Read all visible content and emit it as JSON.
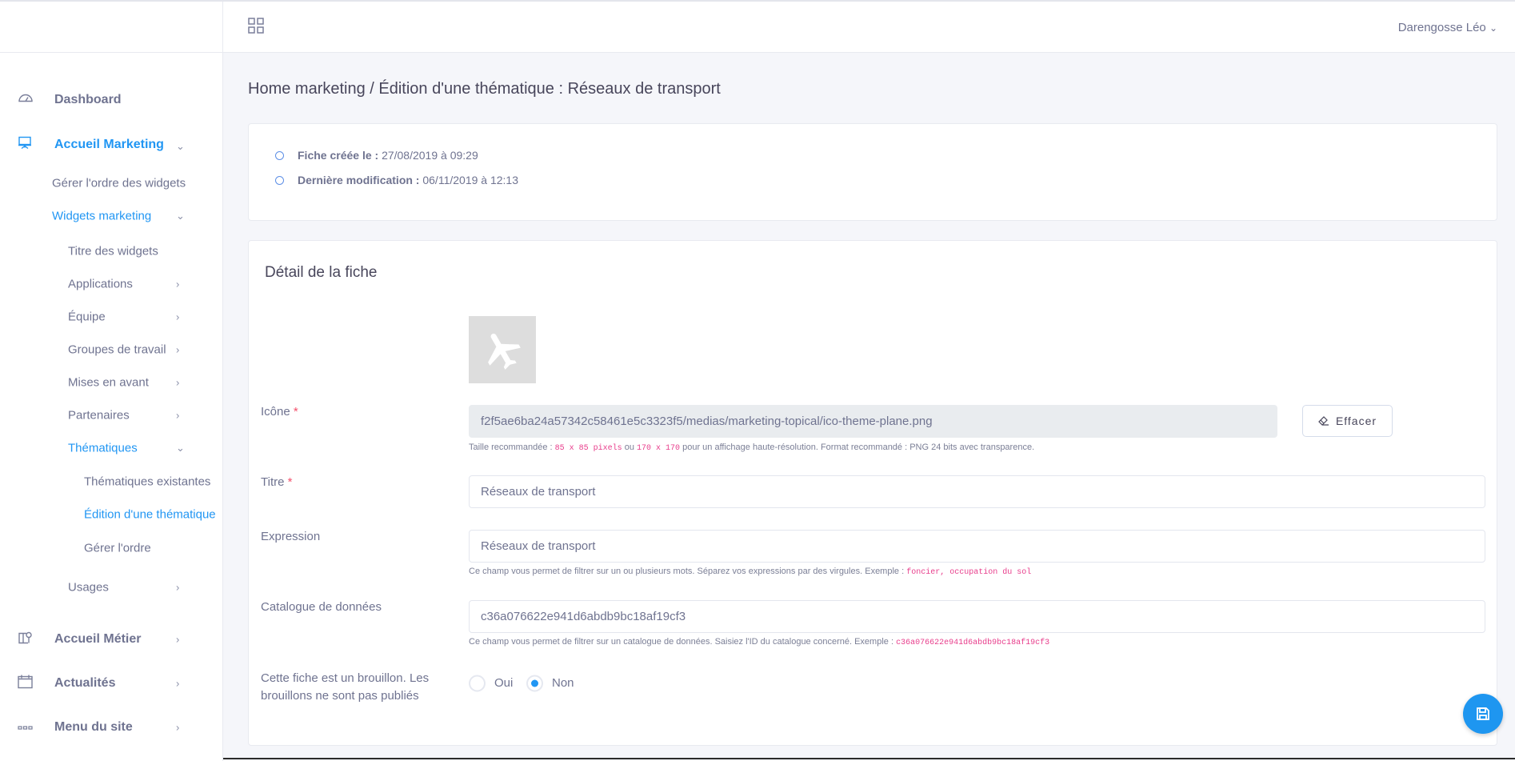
{
  "header": {
    "user_name": "Darengosse Léo",
    "apps_icon": "grid-icon"
  },
  "sidebar": {
    "items": [
      {
        "label": "Dashboard",
        "icon": "gauge-icon"
      },
      {
        "label": "Accueil Marketing",
        "icon": "presentation-icon"
      },
      {
        "label": "Gérer l'ordre des widgets"
      },
      {
        "label": "Widgets marketing"
      },
      {
        "label": "Titre des widgets"
      },
      {
        "label": "Applications"
      },
      {
        "label": "Équipe"
      },
      {
        "label": "Groupes de travail"
      },
      {
        "label": "Mises en avant"
      },
      {
        "label": "Partenaires"
      },
      {
        "label": "Thématiques"
      },
      {
        "label": "Thématiques existantes"
      },
      {
        "label": "Édition d'une thématique"
      },
      {
        "label": "Gérer l'ordre"
      },
      {
        "label": "Usages"
      },
      {
        "label": "Accueil Métier",
        "icon": "map-pin-icon"
      },
      {
        "label": "Actualités",
        "icon": "calendar-icon"
      },
      {
        "label": "Menu du site",
        "icon": "menu-dots-icon"
      }
    ]
  },
  "page": {
    "title": "Home marketing / Édition d'une thématique : Réseaux de transport"
  },
  "info": {
    "created_label": "Fiche créée le :",
    "created_value": "27/08/2019 à 09:29",
    "modified_label": "Dernière modification :",
    "modified_value": "06/11/2019 à 12:13"
  },
  "form": {
    "title": "Détail de la fiche",
    "icon_label": "Icône",
    "icon_value": "f2f5ae6ba24a57342c58461e5c3323f5/medias/marketing-topical/ico-theme-plane.png",
    "icon_help_1": "Taille recommandée :",
    "icon_help_code1": "85 x 85 pixels",
    "icon_help_2": "ou",
    "icon_help_code2": "170 x 170",
    "icon_help_3": "pour un affichage haute-résolution. Format recommandé : PNG 24 bits avec transparence.",
    "clear_label": "Effacer",
    "titre_label": "Titre",
    "titre_value": "Réseaux de transport",
    "expr_label": "Expression",
    "expr_value": "Réseaux de transport",
    "expr_help": "Ce champ vous permet de filtrer sur un ou plusieurs mots. Séparez vos expressions par des virgules. Exemple :",
    "expr_help_code": "foncier, occupation du sol",
    "cat_label": "Catalogue de données",
    "cat_value": "c36a076622e941d6abdb9bc18af19cf3",
    "cat_help": "Ce champ vous permet de filtrer sur un catalogue de données. Saisiez l'ID du catalogue concerné. Exemple :",
    "cat_help_code": "c36a076622e941d6abdb9bc18af19cf3",
    "draft_label_1": "Cette fiche est un brouillon. Les",
    "draft_label_2": "brouillons ne sont pas publiés",
    "draft_options": [
      {
        "label": "Oui",
        "selected": false
      },
      {
        "label": "Non",
        "selected": true
      }
    ]
  },
  "colors": {
    "accent": "#2196f3",
    "background": "#f5f6fa"
  }
}
